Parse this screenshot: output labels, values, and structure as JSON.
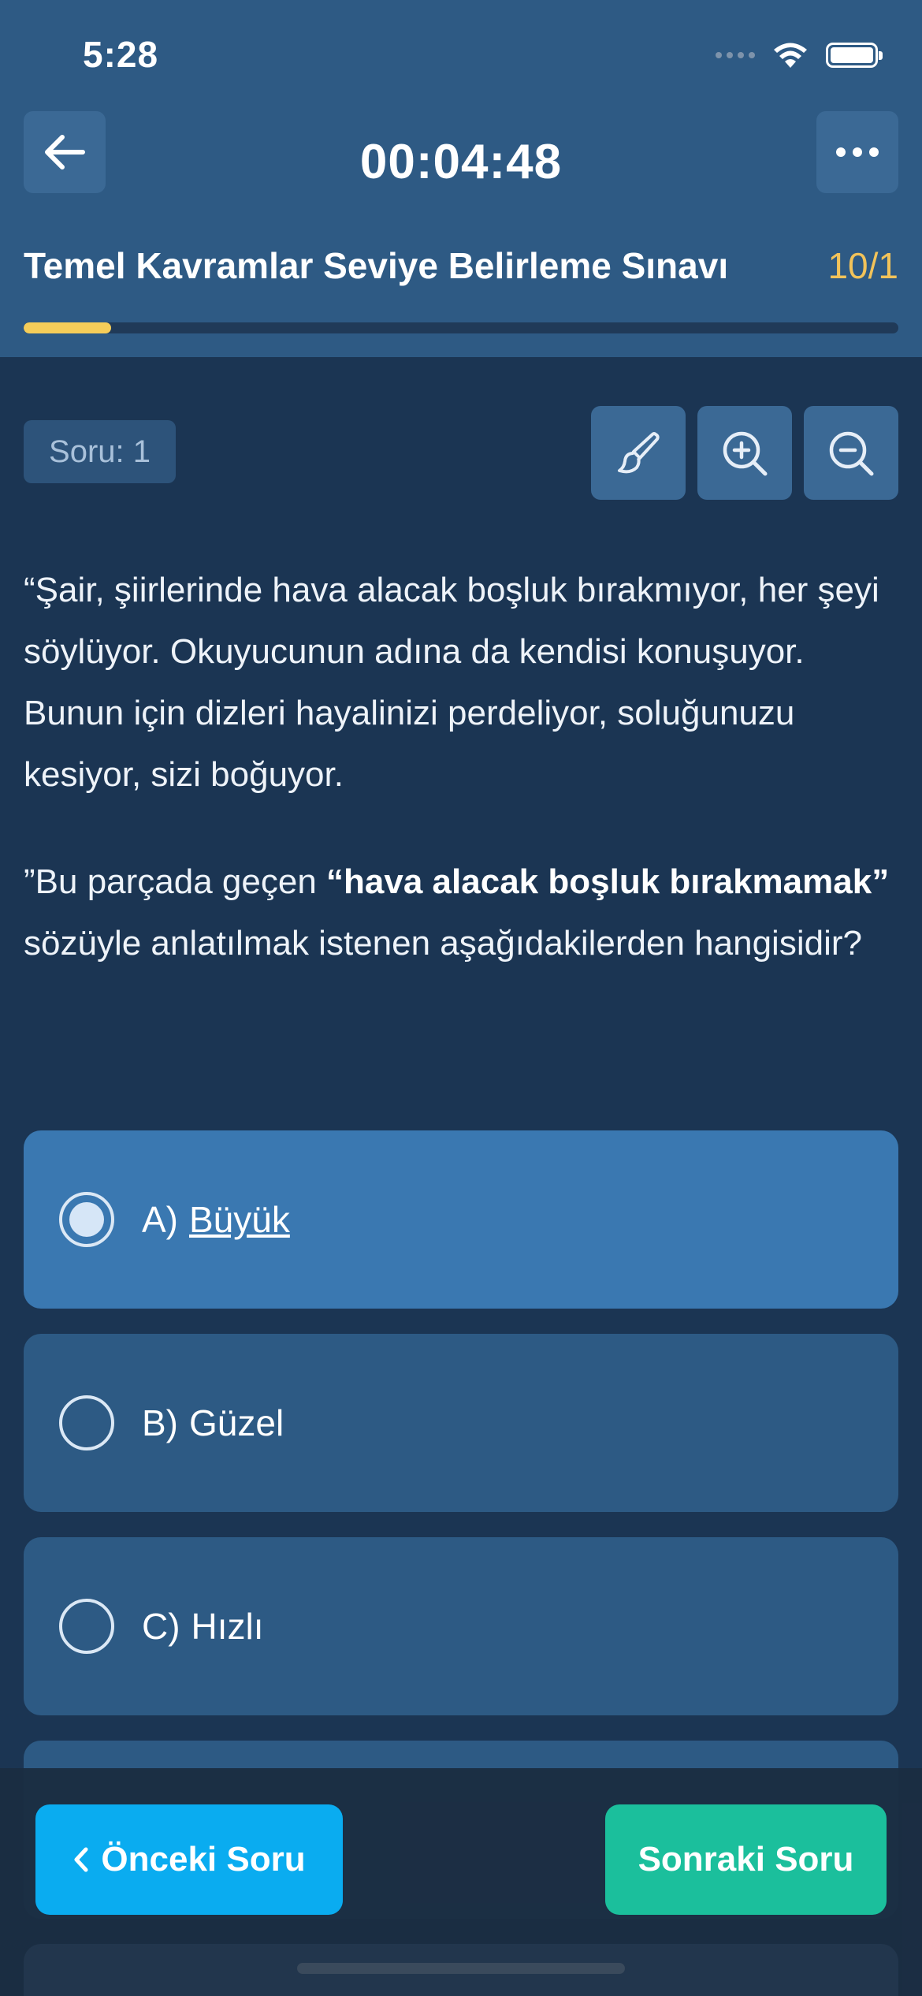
{
  "status_bar": {
    "time": "5:28"
  },
  "header": {
    "timer": "00:04:48",
    "exam_title": "Temel Kavramlar Seviye Belirleme Sınavı",
    "progress_text": "10/1",
    "progress_fraction": 0.1
  },
  "toolbar": {
    "question_label": "Soru: 1",
    "icons": [
      "brush-icon",
      "zoom-in-icon",
      "zoom-out-icon"
    ]
  },
  "question": {
    "passage": "“Şair, şiirlerinde hava alacak boşluk bırakmıyor, her şeyi söylüyor. Okuyucunun adına da kendisi konuşuyor. Bunun için dizleri hayalinizi perdeliyor, soluğunuzu kesiyor, sizi boğuyor.",
    "prompt_before": "”Bu parçada geçen ",
    "prompt_bold": "“hava alacak boşluk bırakmamak”",
    "prompt_after": " sözüyle anlatılmak istenen aşağıdakilerden hangisidir?"
  },
  "options": [
    {
      "letter": "A)",
      "text": "Büyük",
      "selected": true
    },
    {
      "letter": "B)",
      "text": "Güzel",
      "selected": false
    },
    {
      "letter": "C)",
      "text": "Hızlı",
      "selected": false
    }
  ],
  "navigation": {
    "prev_label": "Önceki Soru",
    "next_label": "Sonraki Soru"
  },
  "colors": {
    "header_bg": "#2e5a84",
    "page_bg": "#1b3553",
    "accent_yellow": "#f5cd59",
    "selected_option": "#3a78b1",
    "option_bg": "#2d5a84",
    "prev_button": "#0aacf0",
    "next_button": "#1bbf9c"
  }
}
